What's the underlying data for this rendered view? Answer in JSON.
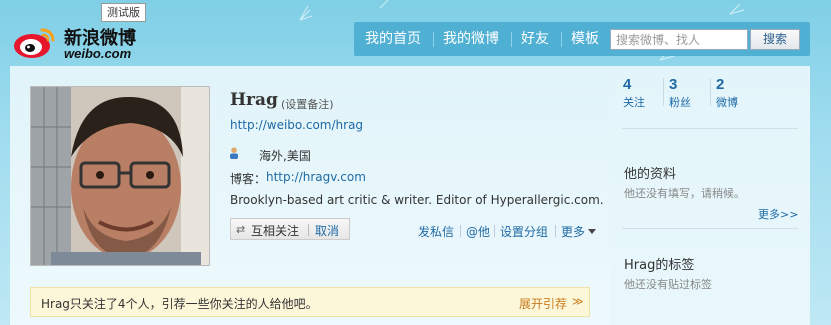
{
  "header": {
    "logo_cn": "新浪微博",
    "logo_en": "weibo.com",
    "beta_badge": "测试版",
    "nav": [
      "我的首页",
      "我的微博",
      "好友",
      "模板"
    ],
    "search_placeholder": "搜索微博、找人",
    "search_button": "搜索"
  },
  "profile": {
    "name": "Hrag",
    "remark_link": "(设置备注)",
    "homepage": "http://weibo.com/hrag",
    "location": "海外,美国",
    "blog_label": "博客：",
    "blog_url": "http://hragv.com",
    "bio": "Brooklyn-based art critic & writer. Editor of Hyperallergic.com.",
    "follow_status": "互相关注",
    "cancel_label": "取消",
    "actions": [
      "发私信",
      "@他",
      "设置分组",
      "更多"
    ]
  },
  "suggest": {
    "text": "Hrag只关注了4个人，引荐一些你关注的人给他吧。",
    "expand": "展开引荐",
    "chevron": "≫"
  },
  "stats": [
    {
      "value": "4",
      "label": "关注"
    },
    {
      "value": "3",
      "label": "粉丝"
    },
    {
      "value": "2",
      "label": "微博"
    }
  ],
  "sidebar": {
    "info_title": "他的资料",
    "info_note": "他还没有填写，请稍候。",
    "more": "更多>>",
    "tags_title": "Hrag的标签",
    "tags_note": "他还没有贴过标签"
  },
  "icons": {
    "follow_swap": "⇄",
    "person": "person-icon",
    "logo": "weibo-eye-logo"
  },
  "colors": {
    "nav_bg": "#4fb0d3",
    "link": "#1f6aa5",
    "expand": "#c77b1c",
    "suggest_bg": "#fdf7d9"
  }
}
